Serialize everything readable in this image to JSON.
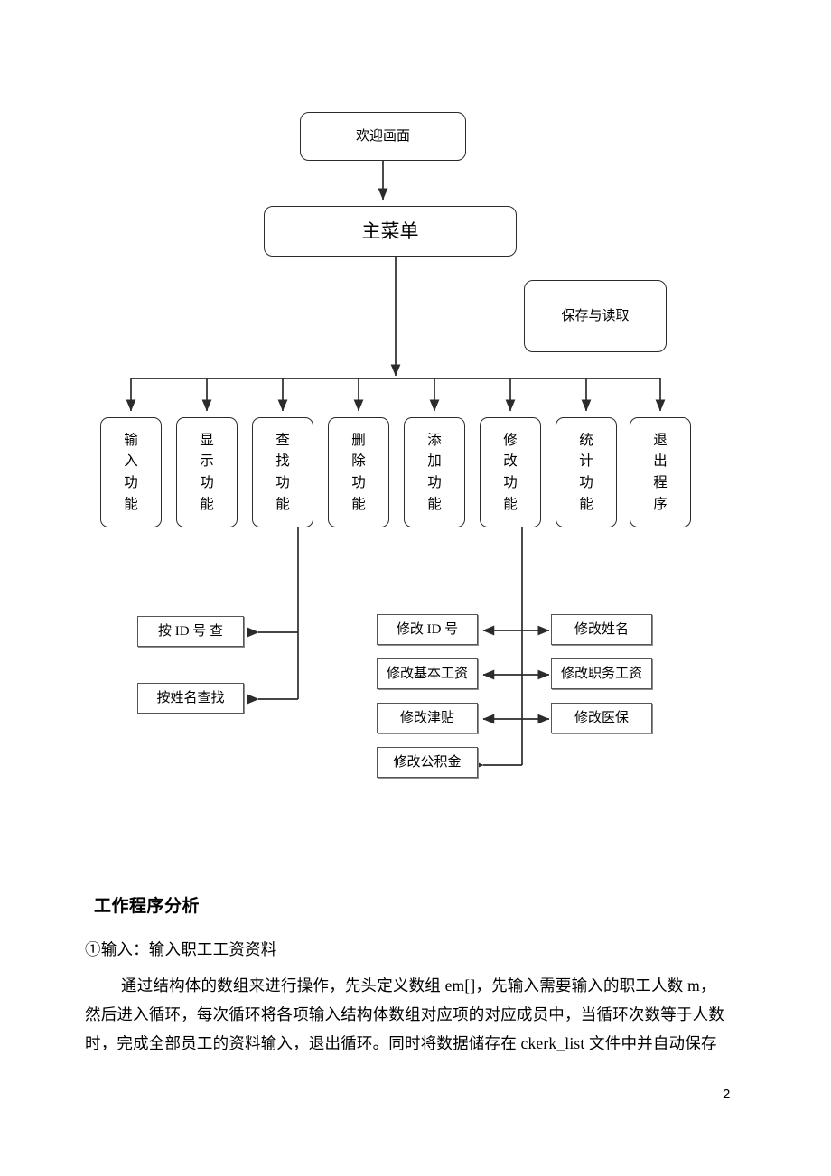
{
  "document": {
    "page_number": "2",
    "section_title": "工作程序分析",
    "paragraph_lines": [
      "①输入：输入职工工资资料",
      "通过结构体的数组来进行操作，先头定义数组 em[]，先输入需要输入的职工人数 m，",
      "然后进入循环，每次循环将各项输入结构体数组对应项的对应成员中，当循环次数等于人数",
      "时，完成全部员工的资料输入，退出循环。同时将数据储存在 ckerk_list 文件中并自动保存"
    ]
  },
  "flowchart": {
    "type": "flowchart",
    "welcome": {
      "label": "欢迎画面"
    },
    "main_menu": {
      "label": "主菜单"
    },
    "save_read": {
      "label": "保存与读取"
    },
    "functions": [
      {
        "label": "输入功能"
      },
      {
        "label": "显示功能"
      },
      {
        "label": "查找功能"
      },
      {
        "label": "删除功能"
      },
      {
        "label": "添加功能"
      },
      {
        "label": "修改功能"
      },
      {
        "label": "统计功能"
      },
      {
        "label": "退出程序"
      }
    ],
    "search_subitems": [
      {
        "label": "按 ID 号 查"
      },
      {
        "label": "按姓名查找"
      }
    ],
    "modify_subitems_left": [
      {
        "label": "修改 ID 号"
      },
      {
        "label": "修改基本工资"
      },
      {
        "label": "修改津贴"
      },
      {
        "label": "修改公积金"
      }
    ],
    "modify_subitems_right": [
      {
        "label": "修改姓名"
      },
      {
        "label": "修改职务工资"
      },
      {
        "label": "修改医保"
      }
    ],
    "colors": {
      "line": "#2b2b2b",
      "box_border": "#2b2b2b",
      "sub_box_border": "#555555",
      "background": "#ffffff"
    }
  }
}
